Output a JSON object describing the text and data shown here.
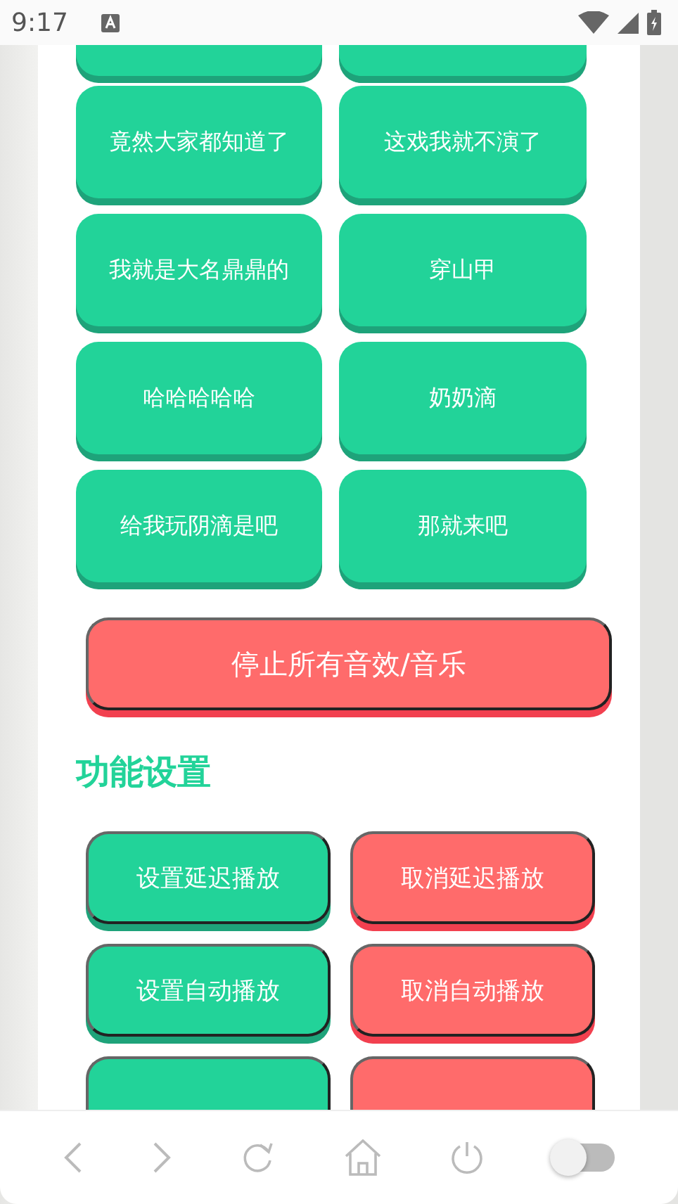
{
  "status_bar": {
    "time": "9:17"
  },
  "sound_buttons": [
    "竟然大家都知道了",
    "这戏我就不演了",
    "我就是大名鼎鼎的",
    "穿山甲",
    "哈哈哈哈哈",
    "奶奶滴",
    "给我玩阴滴是吧",
    "那就来吧"
  ],
  "stop_button": "停止所有音效/音乐",
  "section_title": "功能设置",
  "function_buttons": [
    {
      "label": "设置延迟播放",
      "kind": "set"
    },
    {
      "label": "取消延迟播放",
      "kind": "cancel"
    },
    {
      "label": "设置自动播放",
      "kind": "set"
    },
    {
      "label": "取消自动播放",
      "kind": "cancel"
    },
    {
      "kind": "set"
    },
    {
      "kind": "cancel"
    }
  ],
  "nav_bar": {
    "toggle": {
      "on": false
    }
  }
}
